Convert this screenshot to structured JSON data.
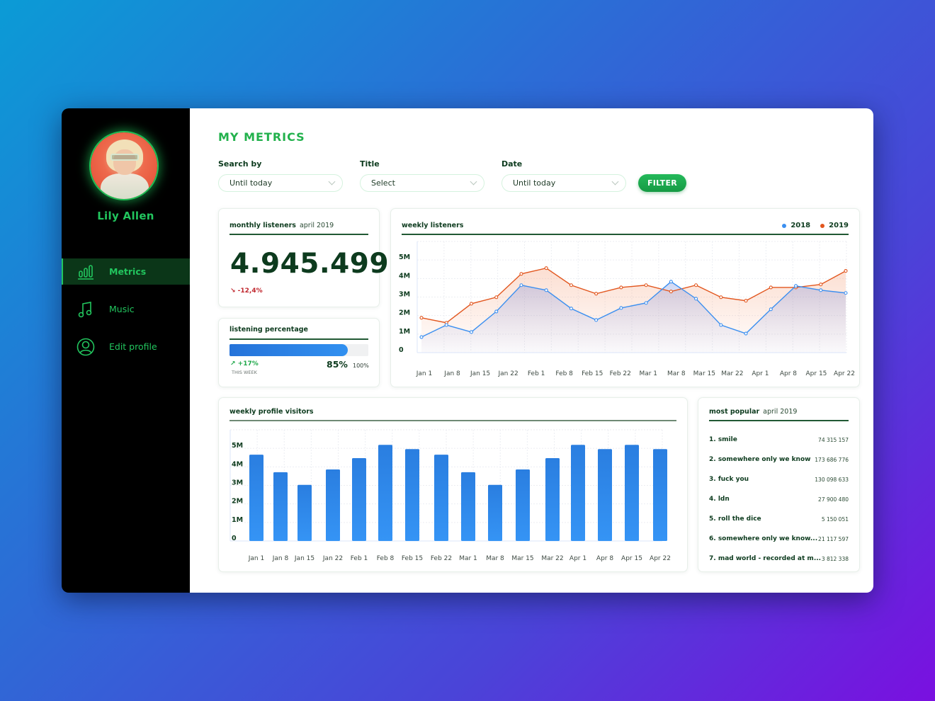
{
  "sidebar": {
    "user_name": "Lily Allen",
    "avatar_icon": "user-photo",
    "items": [
      {
        "label": "Metrics",
        "icon": "bar-chart-icon",
        "active": true
      },
      {
        "label": "Music",
        "icon": "music-note-icon",
        "active": false
      },
      {
        "label": "Edit profile",
        "icon": "user-circle-icon",
        "active": false
      }
    ]
  },
  "header": {
    "title": "MY METRICS"
  },
  "filters": {
    "search_by": {
      "label": "Search by",
      "value": "Until today"
    },
    "title": {
      "label": "Title",
      "value": "Select"
    },
    "date": {
      "label": "Date",
      "value": "Until today"
    },
    "button_label": "FILTER"
  },
  "monthly_listeners": {
    "title": "monthly listeners",
    "period": "april 2019",
    "value": "4.945.499",
    "delta": "↘ -12,4%"
  },
  "listening_percentage": {
    "title": "listening percentage",
    "percent": 85,
    "value_label": "85%",
    "max_label": "100%",
    "delta": "↗ +17%",
    "delta_caption": "THIS WEEK"
  },
  "colors": {
    "brand_green": "#22c55e",
    "dark_green": "#0d3b1e",
    "series_2018": "#3b8ff0",
    "series_2019": "#e2561e",
    "bar_blue": "#2f86ea"
  },
  "chart_data": [
    {
      "type": "line",
      "title": "weekly listeners",
      "xlabel": "",
      "ylabel": "",
      "x_tick_labels": [
        "Jan 1",
        "Jan 8",
        "Jan 15",
        "Jan 22",
        "Feb 1",
        "Feb 8",
        "Feb 15",
        "Feb 22",
        "Mar 1",
        "Mar 8",
        "Mar 15",
        "Mar 22",
        "Apr 1",
        "Apr 8",
        "Apr 15",
        "Apr 22"
      ],
      "y_tick_labels": [
        "0",
        "1M",
        "2M",
        "3M",
        "4M",
        "5M"
      ],
      "ylim": [
        0,
        6000000
      ],
      "grid": true,
      "legend": "top-right",
      "series": [
        {
          "name": "2018",
          "color": "#3b8ff0",
          "values": [
            840000,
            1490000,
            1110000,
            2220000,
            3640000,
            3370000,
            2380000,
            1760000,
            2410000,
            2680000,
            3830000,
            2910000,
            1490000,
            1030000,
            2340000,
            3600000,
            3370000,
            3220000
          ]
        },
        {
          "name": "2019",
          "color": "#e2561e",
          "values": [
            1880000,
            1610000,
            2640000,
            2990000,
            4250000,
            4560000,
            3640000,
            3180000,
            3520000,
            3640000,
            3300000,
            3640000,
            2990000,
            2800000,
            3520000,
            3520000,
            3680000,
            4410000
          ]
        }
      ]
    },
    {
      "type": "bar",
      "title": "weekly profile visitors",
      "xlabel": "",
      "ylabel": "",
      "categories": [
        "Jan 1",
        "Jan 8",
        "Jan 15",
        "Jan 22",
        "Feb 1",
        "Feb 8",
        "Feb 15",
        "Feb 22",
        "Mar 1",
        "Mar 8",
        "Mar 15",
        "Mar 22",
        "Apr 1",
        "Apr 8",
        "Apr 15",
        "Apr 22"
      ],
      "y_tick_labels": [
        "0",
        "1M",
        "2M",
        "3M",
        "4M",
        "5M"
      ],
      "ylim": [
        0,
        6000000
      ],
      "grid": true,
      "values": [
        4660000,
        3710000,
        3030000,
        3860000,
        4470000,
        5190000,
        4960000,
        4660000,
        3710000,
        3030000,
        3860000,
        4470000,
        5190000,
        4960000,
        5190000,
        4960000
      ]
    }
  ],
  "most_popular": {
    "title": "most popular",
    "period": "april 2019",
    "items": [
      {
        "title": "1. smile",
        "count": "74 315 157"
      },
      {
        "title": "2. somewhere only we know",
        "count": "173 686 776"
      },
      {
        "title": "3. fuck you",
        "count": "130 098 633"
      },
      {
        "title": "4. ldn",
        "count": "27 900 480"
      },
      {
        "title": "5. roll the dice",
        "count": "5 150 051"
      },
      {
        "title": "6. somewhere only we know...",
        "count": "21 117 597"
      },
      {
        "title": "7. mad world - recorded at m...",
        "count": "3 812 338"
      }
    ]
  }
}
